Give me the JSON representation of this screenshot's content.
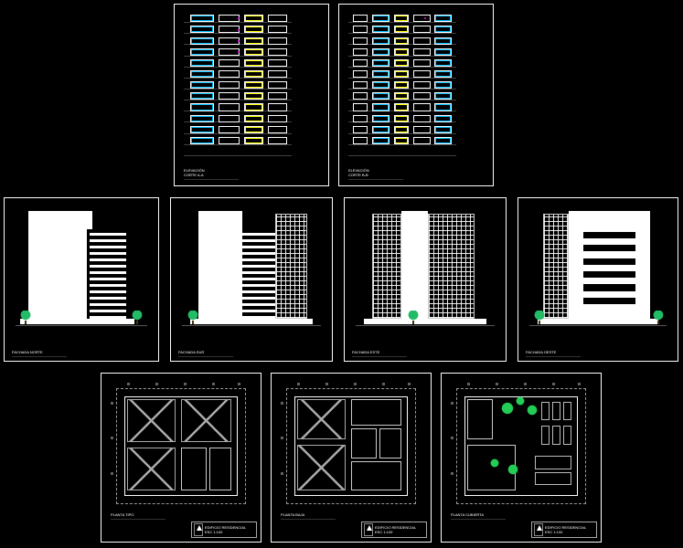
{
  "row1": {
    "sheet_a": {
      "label": "ELEVACIÓN",
      "sublabel": "CORTE A-A"
    },
    "sheet_b": {
      "label": "ELEVACIÓN",
      "sublabel": "CORTE B-B"
    }
  },
  "row2": {
    "sheet_a": {
      "label": "FACHADA NORTE"
    },
    "sheet_b": {
      "label": "FACHADA SUR"
    },
    "sheet_c": {
      "label": "FACHADA ESTE"
    },
    "sheet_d": {
      "label": "FACHADA OESTE"
    }
  },
  "row3": {
    "sheet_a": {
      "label": "PLANTA TIPO",
      "title_block": {
        "project": "EDIFICIO RESIDENCIAL",
        "scale": "ESC 1:100"
      }
    },
    "sheet_b": {
      "label": "PLANTA BAJA",
      "title_block": {
        "project": "EDIFICIO RESIDENCIAL",
        "scale": "ESC 1:100"
      }
    },
    "sheet_c": {
      "label": "PLANTA CUBIERTA",
      "title_block": {
        "project": "EDIFICIO RESIDENCIAL",
        "scale": "ESC 1:100"
      }
    }
  }
}
